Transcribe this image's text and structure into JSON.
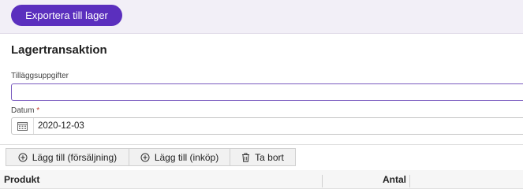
{
  "toolbar": {
    "export_label": "Exportera till lager"
  },
  "form": {
    "title": "Lagertransaktion",
    "extra_info_label": "Tilläggsuppgifter",
    "extra_info_value": "",
    "date_label": "Datum",
    "date_required_mark": "*",
    "date_value": "2020-12-03"
  },
  "actions": {
    "add_sale": "Lägg till (försäljning)",
    "add_purchase": "Lägg till (inköp)",
    "remove": "Ta bort"
  },
  "table": {
    "columns": [
      "Produkt",
      "Antal"
    ]
  },
  "colors": {
    "accent": "#5b2fbe"
  }
}
